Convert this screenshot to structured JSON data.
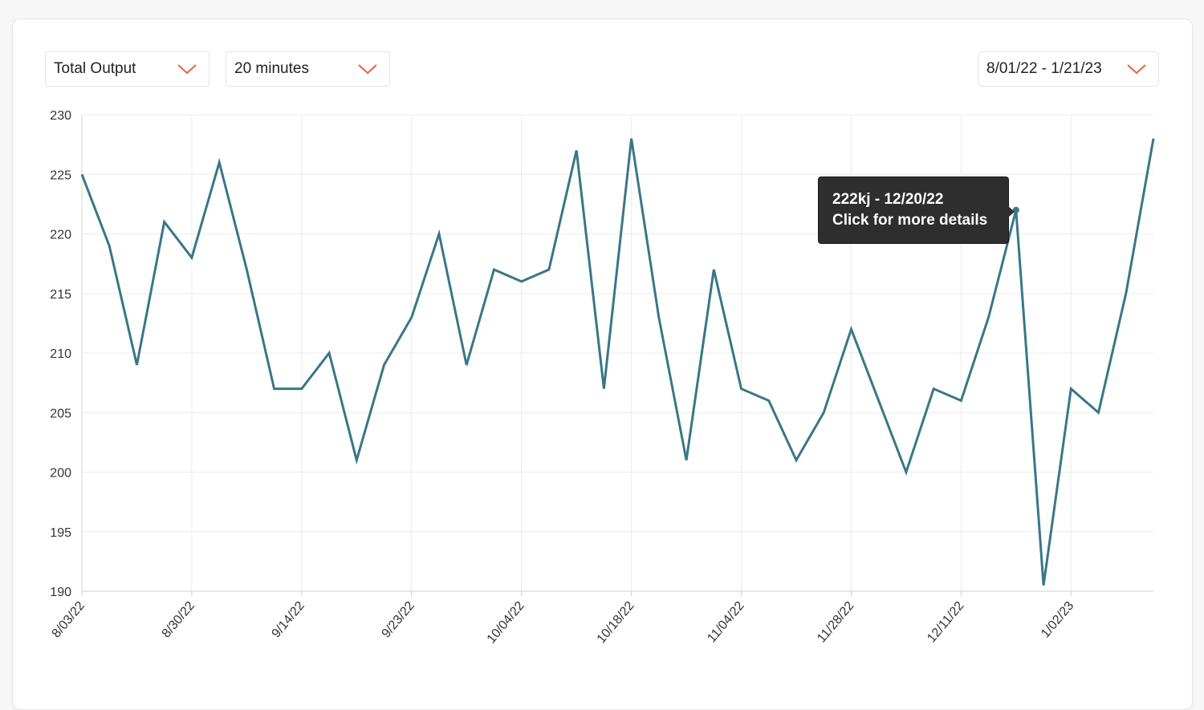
{
  "controls": {
    "metric": "Total Output",
    "interval": "20 minutes",
    "date_range": "8/01/22 - 1/21/23",
    "accent_color": "#e8643c"
  },
  "tooltip": {
    "line1": "222kj - 12/20/22",
    "line2": "Click for more details"
  },
  "chart_data": {
    "type": "line",
    "title": "",
    "xlabel": "",
    "ylabel": "",
    "ylim": [
      190,
      230
    ],
    "yticks": [
      190,
      195,
      200,
      205,
      210,
      215,
      220,
      225,
      230
    ],
    "xtick_labels": [
      "8/03/22",
      "8/30/22",
      "9/14/22",
      "9/23/22",
      "10/04/22",
      "10/18/22",
      "11/04/22",
      "11/28/22",
      "12/11/22",
      "1/02/23"
    ],
    "grid": true,
    "line_color": "#3a7689",
    "highlight_index": 34,
    "series": [
      {
        "values": [
          225,
          219,
          209,
          221,
          218,
          226,
          217,
          207,
          207,
          210,
          201,
          209,
          213,
          220,
          209,
          217,
          216,
          217,
          227,
          207,
          228,
          213,
          201,
          217,
          207,
          206,
          201,
          205,
          212,
          206,
          200,
          207,
          206,
          213,
          222,
          190.5,
          207,
          205,
          215,
          228
        ]
      }
    ]
  }
}
